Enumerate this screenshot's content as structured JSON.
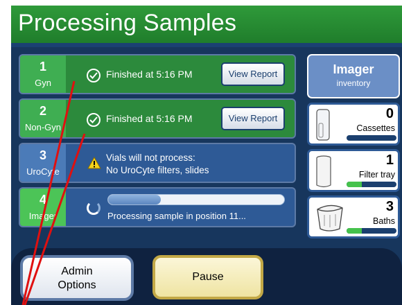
{
  "header": {
    "title": "Processing Samples"
  },
  "rows": [
    {
      "number": "1",
      "label": "Gyn",
      "status": "Finished at  5:16 PM",
      "button": "View Report"
    },
    {
      "number": "2",
      "label": "Non-Gyn",
      "status": "Finished at  5:16 PM",
      "button": "View Report"
    },
    {
      "number": "3",
      "label": "UroCyte",
      "status_line1": "Vials will not process:",
      "status_line2": "No UroCyte filters, slides"
    },
    {
      "number": "4",
      "label": "Imager",
      "status": "Processing sample in position 11...",
      "progress": 0.3
    }
  ],
  "inventory": {
    "title": "Imager",
    "subtitle": "inventory",
    "items": [
      {
        "count": "0",
        "name": "Cassettes",
        "level": 0.0,
        "icon": "cassette-icon"
      },
      {
        "count": "1",
        "name": "Filter tray",
        "level": 0.3,
        "icon": "filter-tray-icon"
      },
      {
        "count": "3",
        "name": "Baths",
        "level": 0.3,
        "icon": "bath-icon"
      }
    ]
  },
  "buttons": {
    "admin_line1": "Admin",
    "admin_line2": "Options",
    "pause": "Pause"
  },
  "colors": {
    "title_green": "#2f9a3a",
    "row_green": "#2c8a3c",
    "row_blue": "#2e5a96",
    "background": "#17365d",
    "annotation_red": "#e01010"
  }
}
